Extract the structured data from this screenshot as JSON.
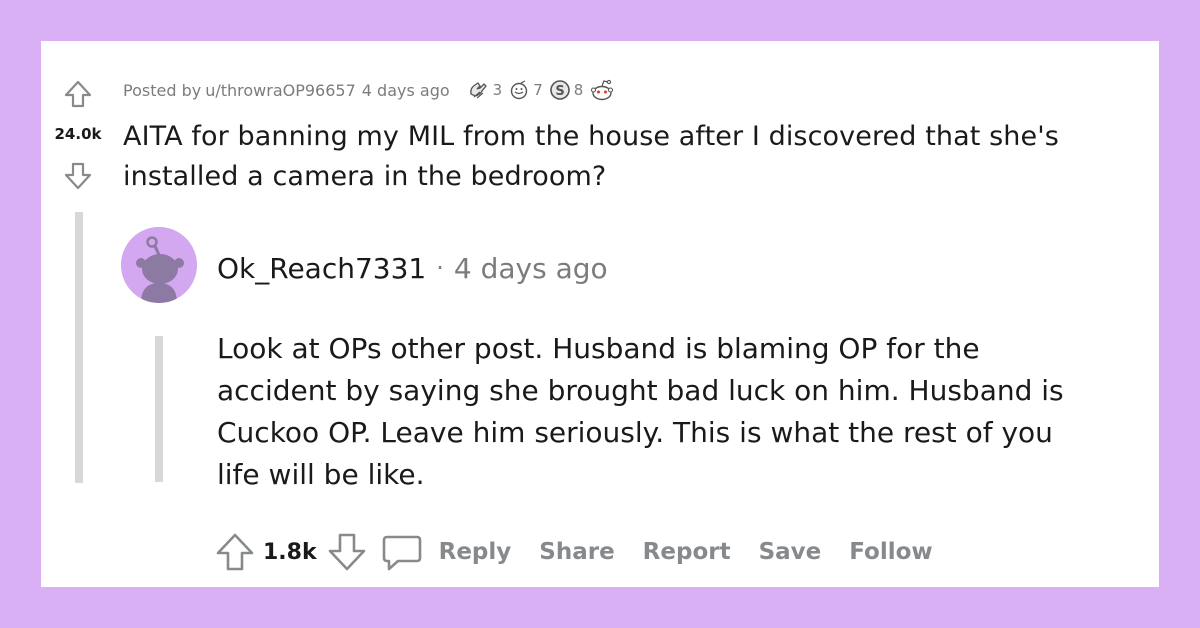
{
  "post": {
    "meta_prefix": "Posted by",
    "author": "u/throwraOP96657",
    "time": "4 days ago",
    "score": "24.0k",
    "title": "AITA for banning my MIL from the house after I discovered that she's installed a camera in the bedroom?",
    "awards": [
      {
        "icon": "hands-award-icon",
        "count": "3"
      },
      {
        "icon": "face-award-icon",
        "count": "7"
      },
      {
        "icon": "silver-award-icon",
        "count": "8"
      },
      {
        "icon": "snoo-award-icon",
        "count": ""
      }
    ]
  },
  "comment": {
    "author": "Ok_Reach7331",
    "separator": "·",
    "time": "4 days ago",
    "body": "Look at OPs other post. Husband is blaming OP for the accident by saying she brought bad luck on him. Husband is Cuckoo OP. Leave him seriously. This is what the rest of you life will be like.",
    "score": "1.8k",
    "actions": {
      "reply": "Reply",
      "share": "Share",
      "report": "Report",
      "save": "Save",
      "follow": "Follow"
    }
  },
  "colors": {
    "background": "#d9b0f3",
    "card": "#ffffff",
    "text": "#1a1a1b",
    "muted": "#7c7c7c",
    "action": "#878a8c",
    "thread_line": "#d8d8d8",
    "avatar_bg": "#d4a8f0"
  }
}
